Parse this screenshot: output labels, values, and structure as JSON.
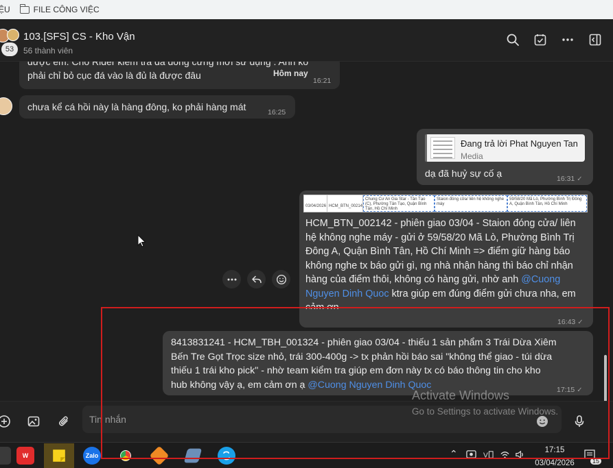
{
  "bookmarks": [
    {
      "label": "ỆU"
    },
    {
      "label": "FILE CÔNG VIỆC"
    }
  ],
  "header": {
    "title": "103.[SFS] CS - Kho Vận",
    "members": "56 thành viên",
    "member_badge": "53"
  },
  "messages": [
    {
      "side": "in",
      "lines": [
        "được em. Cho Rider kiểm tra đá đông cứng mới sử dụng . Anh ko",
        "phải chỉ bỏ cục đá vào là đủ là được đâu"
      ],
      "date_label": "Hôm nay",
      "time": "16:21"
    },
    {
      "side": "in",
      "text": "chưa kể cá hồi này là hàng đông, ko phải hàng mát",
      "time": "16:25"
    },
    {
      "side": "out",
      "reply_title": "Đang trả lời Phat Nguyen Tan",
      "reply_sub": "Media",
      "text": "dạ đã huỷ sự cố ạ",
      "time": "16:31"
    },
    {
      "side": "out",
      "sheet_cells": [
        "03/04/2026",
        "HCM_BTN_002142",
        "Chung Cư An Gia Star - Tân Tạo (C), Phường Tân Tạo, Quận Bình Tân, Hồ Chí Minh",
        "Staion đóng cửa/ liên hệ không nghe máy",
        "59/58/20 Mã Lò, Phường Bình Trị Đông A, Quận Bình Tân, Hồ Chí Minh"
      ],
      "lines": [
        "HCM_BTN_002142  - phiên giao 03/04 - Staion đóng cửa/ liên",
        "hệ không nghe máy - gửi ở 59/58/20 Mã Lò, Phường Bình Trị",
        "Đông A, Quận Bình Tân, Hồ Chí Minh => điểm giữ hàng báo",
        "không nghe tx báo gửi gì, ng nhà nhận hàng thì báo chỉ nhận",
        "hàng của điểm thôi, không có hàng gửi, nhờ anh "
      ],
      "mention_part1": "@Cuong",
      "mention_part2": "Nguyen Dinh Quoc",
      "after_mention": " ktra giúp em đúng điểm gửi chưa nha, em",
      "last_line": "cảm ơn",
      "time": "16:43"
    },
    {
      "side": "out",
      "lines": [
        "8413831241 - HCM_TBH_001324 -  phiên giao 03/04 -  thiếu 1 sản phẩm 3 Trái Dừa Xiêm",
        "Bến Tre Gọt Trọc size nhỏ, trái 300-400g -> tx phản  hồi báo sai \"không thể giao - túi dừa",
        "thiếu 1 trái kho pick\" - nhờ team kiểm tra giúp em đơn này tx có báo thông tin cho kho",
        "hub không vậy ạ, em cảm ơn ạ "
      ],
      "mention": "@Cuong Nguyen Dinh Quoc",
      "time": "17:15"
    }
  ],
  "composer": {
    "placeholder": "Tin nhắn"
  },
  "watermark": {
    "title": "Activate Windows",
    "subtitle": "Go to Settings to activate Windows."
  },
  "taskbar": {
    "apps": [
      "W",
      "",
      "Zalo",
      "",
      "",
      "",
      ""
    ],
    "clock_time": "17:15",
    "clock_date": "03/04/2026",
    "notif_count": "15"
  },
  "colors": {
    "accent_mention": "#4f8fe6",
    "annotation_box": "#d01d1d",
    "bubble_out": "#3d3d3d",
    "bubble_in": "#2f2f2f"
  },
  "icons": [
    "search-icon",
    "todo-icon",
    "more-icon",
    "sidebar-toggle-icon",
    "add-icon",
    "image-icon",
    "attach-icon",
    "emoji-icon",
    "mic-icon",
    "reply-icon",
    "react-icon"
  ]
}
